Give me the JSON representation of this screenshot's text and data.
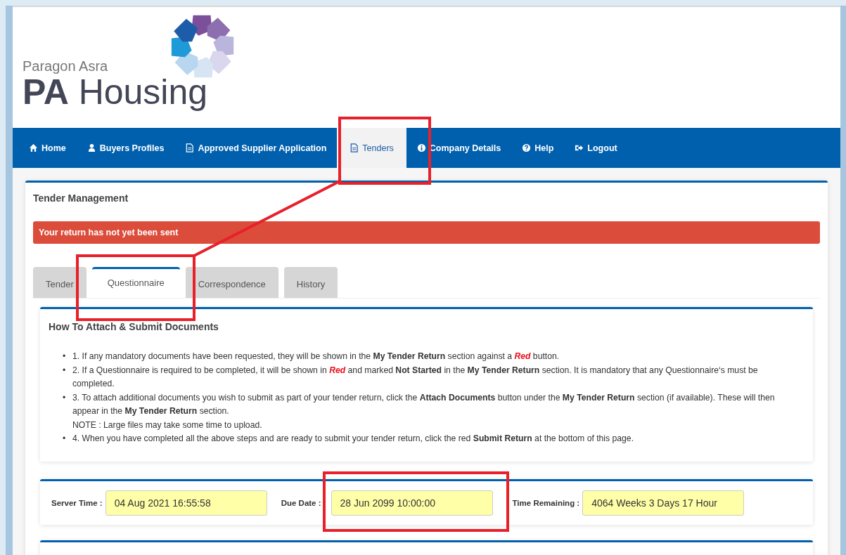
{
  "header": {
    "tagline": "Paragon Asra",
    "brand": "**PA** Housing"
  },
  "nav": [
    {
      "label": "Home",
      "selected": false
    },
    {
      "label": "Buyers Profiles",
      "selected": false
    },
    {
      "label": "Approved Supplier Application",
      "selected": false
    },
    {
      "label": "Tenders",
      "selected": true
    },
    {
      "label": "Company Details",
      "selected": false
    },
    {
      "label": "Help",
      "selected": false
    },
    {
      "label": "Logout",
      "selected": false
    }
  ],
  "panel": {
    "title": "Tender Management",
    "alert": "Your return has not yet been sent"
  },
  "tabs": [
    {
      "label": "Tender",
      "selected": false
    },
    {
      "label": "Questionnaire",
      "selected": true
    },
    {
      "label": "Correspondence",
      "selected": false
    },
    {
      "label": "History",
      "selected": false
    }
  ],
  "instructions": {
    "title": "How To Attach & Submit Documents",
    "items": [
      {
        "marker": "•",
        "text": "1. If any mandatory documents have been requested, they will be shown in the **My Tender Return** section against a *Red* button."
      },
      {
        "marker": "•",
        "text": "2. If a Questionnaire is required to be completed, it will be shown in *Red* and marked **Not Started** in the **My Tender Return** section. It is mandatory that any Questionnaire‘s must be completed."
      },
      {
        "marker": "•",
        "text": "3. To attach additional documents you wish to submit as part of your tender return, click the **Attach Documents** button under the **My Tender Return** section (if available). These will then appear in the **My Tender Return** section.",
        "note": "NOTE : Large files may take some time to upload."
      },
      {
        "marker": "•",
        "text": "4. When you have completed all the above steps and are ready to submit your tender return, click the red **Submit Return** at the bottom of this page."
      }
    ]
  },
  "times": [
    {
      "label": "Server Time :",
      "value": "04 Aug 2021 16:55:58"
    },
    {
      "label": "Due Date :",
      "value": "28 Jun 2099 10:00:00"
    },
    {
      "label": "Time Remaining :",
      "value": "4064 Weeks 3 Days 17 Hour"
    }
  ]
}
